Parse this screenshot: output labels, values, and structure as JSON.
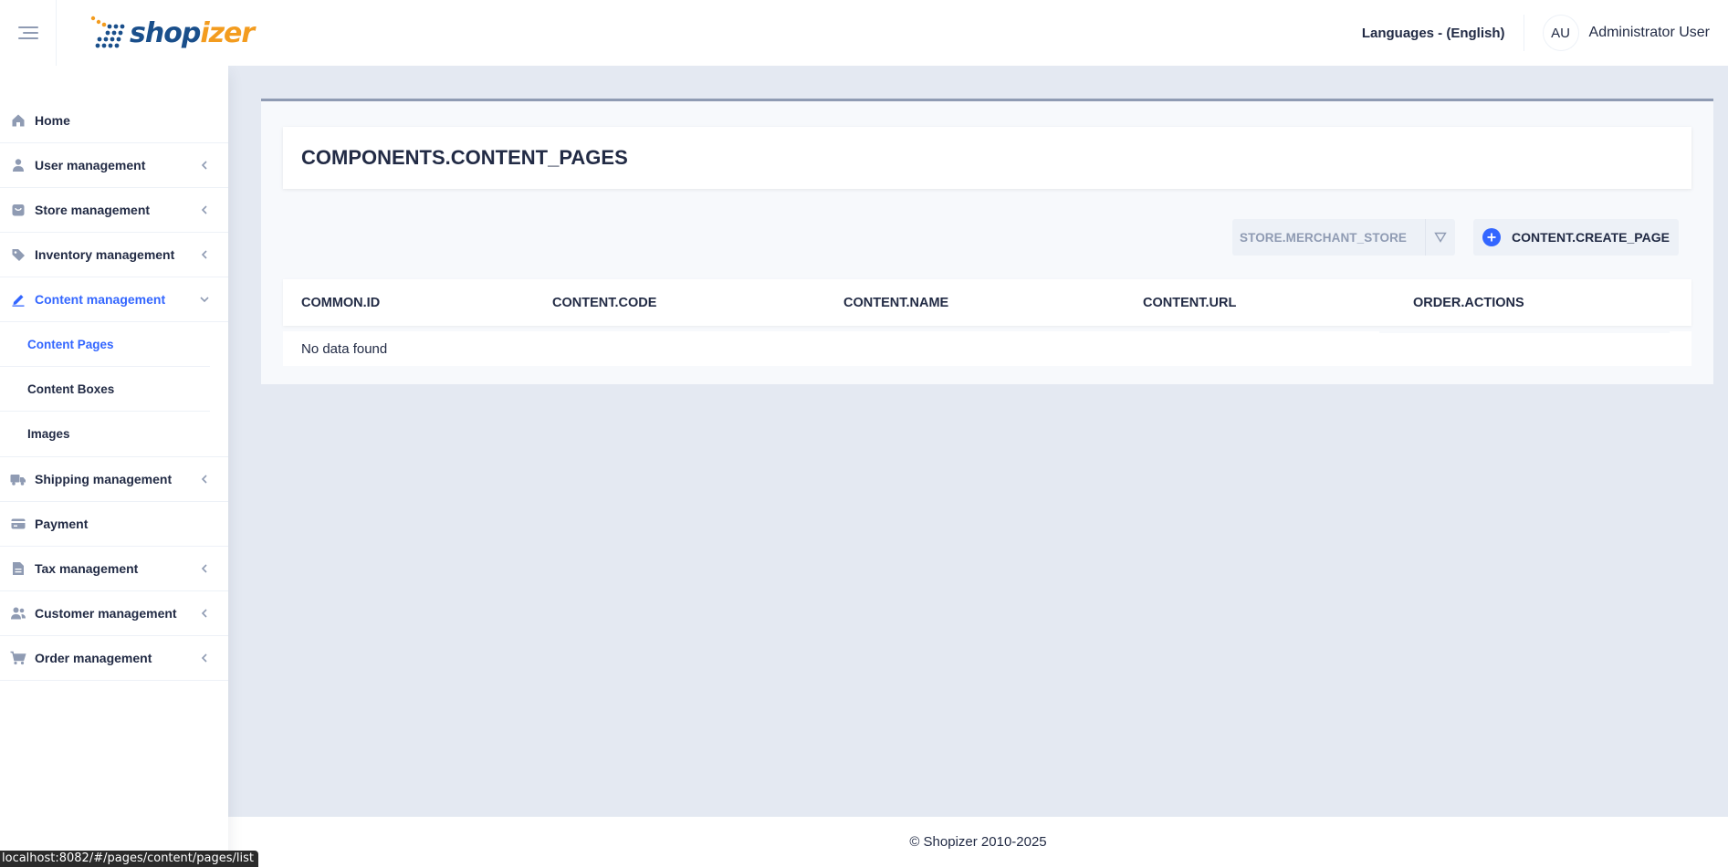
{
  "header": {
    "logo": {
      "part1": "shop",
      "part2": "izer"
    },
    "language_label": "Languages - (English)",
    "user": {
      "initials": "AU",
      "name": "Administrator User"
    }
  },
  "sidebar": {
    "items": [
      {
        "label": "Home",
        "icon": "home-icon",
        "has_chevron": false
      },
      {
        "label": "User management",
        "icon": "person-icon",
        "has_chevron": true
      },
      {
        "label": "Store management",
        "icon": "store-bag-icon",
        "has_chevron": true
      },
      {
        "label": "Inventory management",
        "icon": "pricetag-icon",
        "has_chevron": true
      },
      {
        "label": "Content management",
        "icon": "edit-icon",
        "has_chevron": true,
        "expanded": true,
        "active": true
      },
      {
        "label": "Shipping management",
        "icon": "truck-icon",
        "has_chevron": true
      },
      {
        "label": "Payment",
        "icon": "credit-card-icon",
        "has_chevron": false
      },
      {
        "label": "Tax management",
        "icon": "file-text-icon",
        "has_chevron": true
      },
      {
        "label": "Customer management",
        "icon": "people-icon",
        "has_chevron": true
      },
      {
        "label": "Order management",
        "icon": "shopping-cart-icon",
        "has_chevron": true
      }
    ],
    "content_submenu": [
      {
        "label": "Content Pages",
        "active": true
      },
      {
        "label": "Content Boxes"
      },
      {
        "label": "Images"
      }
    ]
  },
  "main": {
    "title": "COMPONENTS.CONTENT_PAGES",
    "store_select": {
      "value": "STORE.MERCHANT_STORE"
    },
    "create_button": "CONTENT.CREATE_PAGE",
    "table": {
      "columns": [
        "COMMON.ID",
        "CONTENT.CODE",
        "CONTENT.NAME",
        "CONTENT.URL",
        "ORDER.ACTIONS"
      ],
      "empty_message": "No data found"
    }
  },
  "footer": {
    "text": "© Shopizer 2010-2025"
  },
  "status_bar": {
    "url": "localhost:8082/#/pages/content/pages/list"
  },
  "colors": {
    "accent": "#3366ff",
    "text": "#222b45",
    "muted": "#8f9bb3",
    "background": "#e4e9f2",
    "logo_blue": "#1a4f8b",
    "logo_orange": "#f39c1f"
  }
}
